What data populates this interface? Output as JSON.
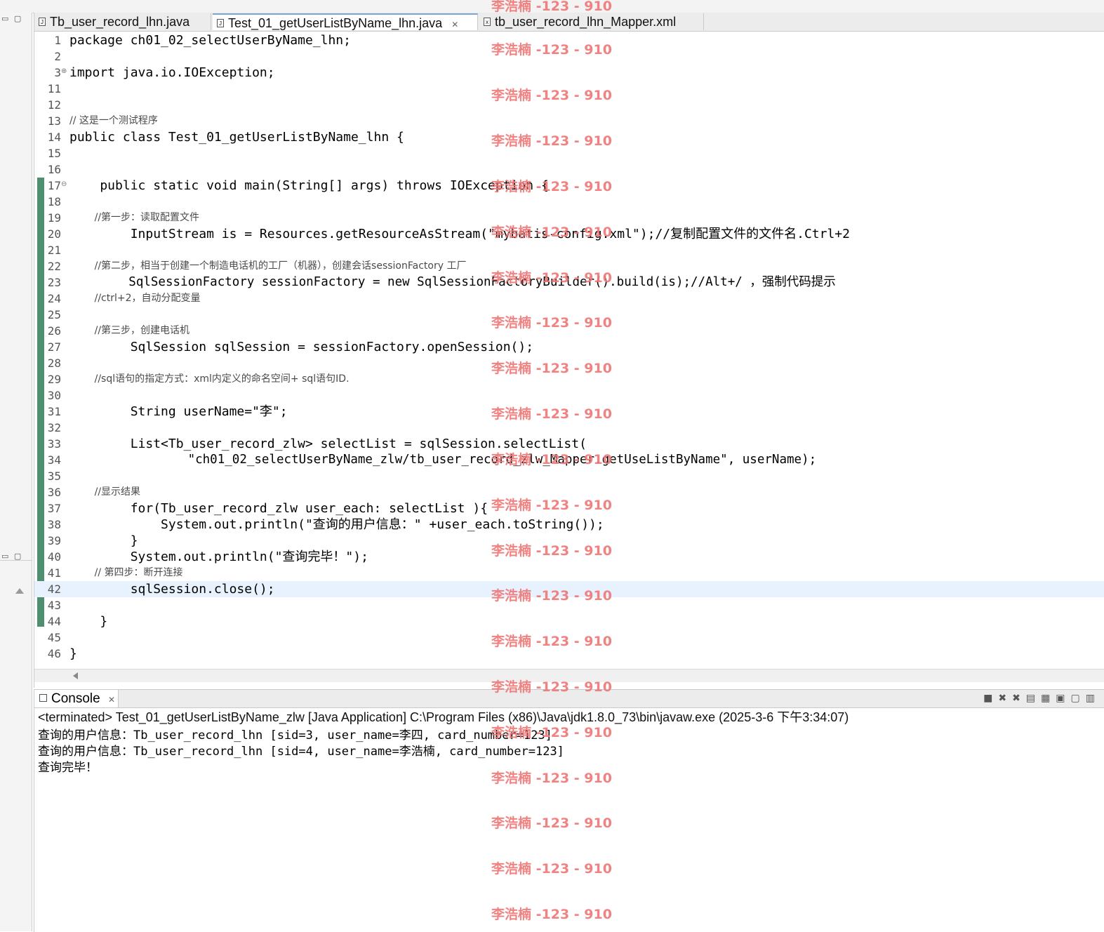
{
  "tabs": [
    {
      "label": "Tb_user_record_lhn.java",
      "icon": "java-file-icon"
    },
    {
      "label": "Test_01_getUserListByName_lhn.java",
      "icon": "java-file-icon",
      "active": true
    },
    {
      "label": "tb_user_record_lhn_Mapper.xml",
      "icon": "xml-file-icon"
    }
  ],
  "code": {
    "line_numbers": [
      "1",
      "2",
      "3",
      "11",
      "12",
      "13",
      "14",
      "15",
      "16",
      "17",
      "18",
      "19",
      "20",
      "21",
      "22",
      "23",
      "24",
      "25",
      "26",
      "27",
      "28",
      "29",
      "30",
      "31",
      "32",
      "33",
      "34",
      "35",
      "36",
      "37",
      "38",
      "39",
      "40",
      "41",
      "42",
      "43",
      "44",
      "45",
      "46"
    ],
    "l1": "package ch01_02_selectUserByName_lhn;",
    "l3": "import java.io.IOException;",
    "l13": "// 这是一个测试程序",
    "l14": "public class Test_01_getUserListByName_lhn {",
    "l17": "    public static void main(String[] args) throws IOException {",
    "l19": "        //第一步：读取配置文件",
    "l20": "        InputStream is = Resources.getResourceAsStream(\"mybatis-config.xml\");//复制配置文件的文件名.Ctrl+2",
    "l22": "        //第二步，相当于创建一个制造电话机的工厂（机器），创建会话sessionFactory 工厂",
    "l23": "        SqlSessionFactory sessionFactory = new SqlSessionFactoryBuilder().build(is);//Alt+/ ，强制代码提示",
    "l24": "        //ctrl+2，自动分配变量",
    "l26": "        //第三步，创建电话机",
    "l27": "        SqlSession sqlSession = sessionFactory.openSession();",
    "l29": "        //sql语句的指定方式：xml内定义的命名空间+ sql语句ID.",
    "l31": "        String userName=\"李\";",
    "l33": "        List<Tb_user_record_zlw> selectList = sqlSession.selectList(",
    "l34": "                \"ch01_02_selectUserByName_zlw/tb_user_record_zlw_Mapper.getUseListByName\", userName);",
    "l36": "        //显示结果",
    "l37": "        for(Tb_user_record_zlw user_each: selectList ){",
    "l38": "            System.out.println(\"查询的用户信息：\" +user_each.toString());",
    "l39": "        }",
    "l40": "        System.out.println(\"查询完毕！\");",
    "l41": "        // 第四步：断开连接",
    "l42": "        sqlSession.close();",
    "l44": "    }",
    "l46": "}"
  },
  "console": {
    "tab_label": "Console",
    "terminated": "<terminated> Test_01_getUserListByName_zlw [Java Application] C:\\Program Files (x86)\\Java\\jdk1.8.0_73\\bin\\javaw.exe (2025-3-6 下午3:34:07)",
    "output": [
      "查询的用户信息：Tb_user_record_lhn [sid=3, user_name=李四, card_number=123]",
      "查询的用户信息：Tb_user_record_lhn [sid=4, user_name=李浩楠, card_number=123]",
      "查询完毕！"
    ]
  },
  "watermark": "李浩楠 -123 - 910",
  "colors": {
    "watermark": "#f07878",
    "gutter_marker": "#4d8f6e",
    "current_line": "#e8f2fe"
  }
}
